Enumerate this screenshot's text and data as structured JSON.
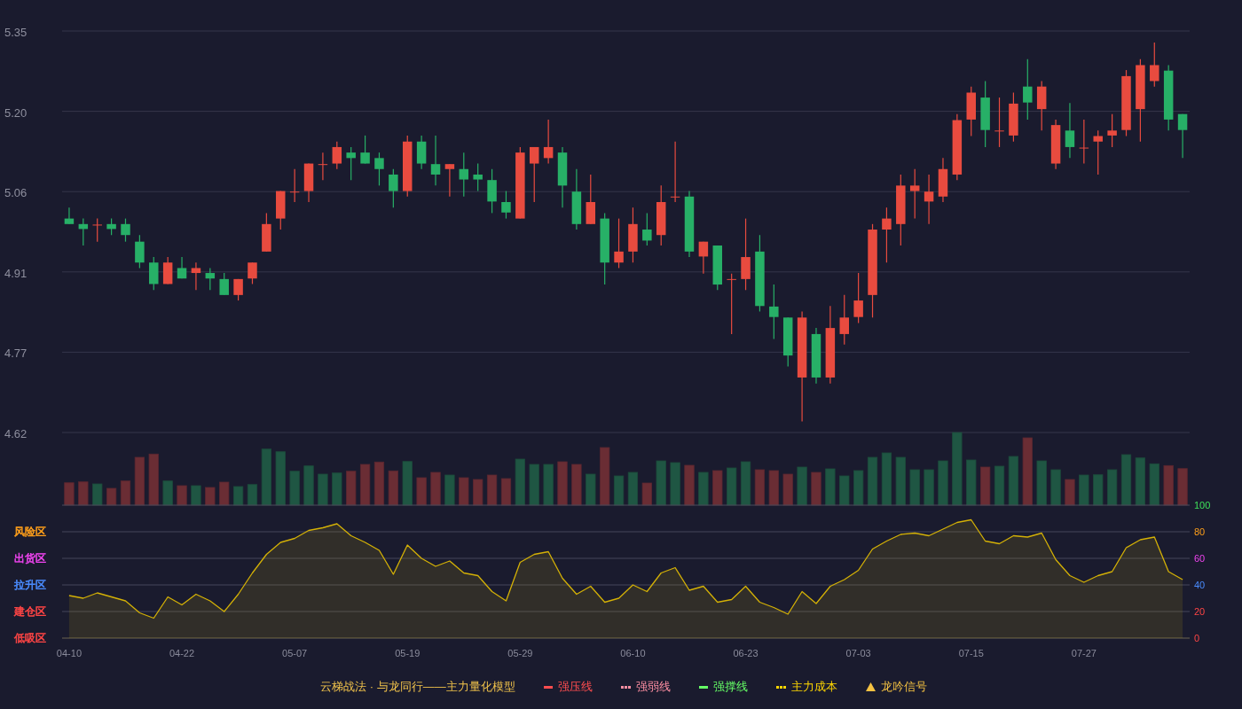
{
  "price_chart": {
    "chart_data": {
      "type": "candlestick",
      "categories": [
        null,
        null,
        null,
        null,
        null,
        null,
        null,
        null,
        null,
        null,
        null,
        null,
        null,
        null,
        null,
        null,
        null,
        null,
        null,
        null,
        null,
        null,
        null,
        null,
        null,
        null,
        null,
        null,
        null,
        null,
        null,
        null,
        null,
        null,
        null,
        null,
        null,
        null,
        null,
        null,
        null,
        null,
        null,
        null,
        null,
        null,
        null,
        null,
        null,
        null,
        null,
        null,
        null,
        null,
        null,
        null,
        null,
        null,
        null,
        null,
        null,
        null,
        null,
        null,
        null,
        null,
        null,
        null,
        null,
        null,
        null,
        null,
        null,
        null,
        null,
        null,
        null,
        null,
        null,
        null
      ],
      "ylim": [
        4.62,
        5.35
      ],
      "yticks": [
        {
          "value": 5.35,
          "label": "5.35"
        },
        {
          "value": 5.204,
          "label": "5.20"
        },
        {
          "value": 5.058,
          "label": "5.06"
        },
        {
          "value": 4.912,
          "label": "4.91"
        },
        {
          "value": 4.766,
          "label": "4.77"
        },
        {
          "value": 4.62,
          "label": "4.62"
        }
      ],
      "grid": true,
      "ohlc": [
        [
          5.009,
          5.029,
          4.999,
          4.999
        ],
        [
          4.999,
          5.009,
          4.96,
          4.99
        ],
        [
          4.998,
          5.009,
          4.967,
          4.998
        ],
        [
          4.999,
          5.009,
          4.979,
          4.99
        ],
        [
          4.999,
          5.009,
          4.967,
          4.979
        ],
        [
          4.967,
          4.979,
          4.919,
          4.929
        ],
        [
          4.929,
          4.939,
          4.879,
          4.89
        ],
        [
          4.89,
          4.939,
          4.89,
          4.929
        ],
        [
          4.919,
          4.939,
          4.9,
          4.9
        ],
        [
          4.91,
          4.929,
          4.879,
          4.919
        ],
        [
          4.91,
          4.919,
          4.879,
          4.9
        ],
        [
          4.899,
          4.91,
          4.87,
          4.87
        ],
        [
          4.87,
          4.899,
          4.86,
          4.899
        ],
        [
          4.9,
          4.929,
          4.89,
          4.929
        ],
        [
          4.949,
          5.019,
          4.949,
          4.999
        ],
        [
          5.009,
          5.059,
          4.989,
          5.059
        ],
        [
          5.058,
          5.099,
          5.039,
          5.058
        ],
        [
          5.059,
          5.109,
          5.039,
          5.109
        ],
        [
          5.108,
          5.129,
          5.079,
          5.108
        ],
        [
          5.109,
          5.149,
          5.099,
          5.139
        ],
        [
          5.129,
          5.139,
          5.079,
          5.119
        ],
        [
          5.129,
          5.16,
          5.109,
          5.109
        ],
        [
          5.119,
          5.129,
          5.069,
          5.099
        ],
        [
          5.089,
          5.099,
          5.029,
          5.059
        ],
        [
          5.059,
          5.16,
          5.049,
          5.149
        ],
        [
          5.149,
          5.16,
          5.099,
          5.109
        ],
        [
          5.108,
          5.16,
          5.069,
          5.089
        ],
        [
          5.099,
          5.108,
          5.049,
          5.108
        ],
        [
          5.099,
          5.129,
          5.049,
          5.08
        ],
        [
          5.089,
          5.109,
          5.059,
          5.08
        ],
        [
          5.079,
          5.099,
          5.019,
          5.04
        ],
        [
          5.039,
          5.059,
          5.009,
          5.02
        ],
        [
          5.009,
          5.139,
          5.009,
          5.129
        ],
        [
          5.109,
          5.139,
          5.039,
          5.139
        ],
        [
          5.119,
          5.189,
          5.109,
          5.139
        ],
        [
          5.129,
          5.139,
          5.029,
          5.069
        ],
        [
          5.058,
          5.099,
          4.989,
          4.999
        ],
        [
          4.999,
          5.089,
          4.999,
          5.039
        ],
        [
          5.009,
          5.019,
          4.889,
          4.929
        ],
        [
          4.929,
          5.009,
          4.919,
          4.949
        ],
        [
          4.949,
          5.029,
          4.929,
          4.999
        ],
        [
          4.989,
          5.019,
          4.96,
          4.969
        ],
        [
          4.979,
          5.069,
          4.96,
          5.039
        ],
        [
          5.049,
          5.149,
          5.039,
          5.049
        ],
        [
          5.049,
          5.059,
          4.939,
          4.949
        ],
        [
          4.94,
          4.967,
          4.909,
          4.967
        ],
        [
          4.96,
          4.96,
          4.879,
          4.889
        ],
        [
          4.899,
          4.909,
          4.799,
          4.899
        ],
        [
          4.899,
          5.009,
          4.879,
          4.939
        ],
        [
          4.949,
          4.979,
          4.84,
          4.85
        ],
        [
          4.849,
          4.889,
          4.79,
          4.83
        ],
        [
          4.829,
          4.829,
          4.74,
          4.76
        ],
        [
          4.72,
          4.84,
          4.64,
          4.829
        ],
        [
          4.799,
          4.81,
          4.709,
          4.72
        ],
        [
          4.72,
          4.85,
          4.709,
          4.81
        ],
        [
          4.799,
          4.87,
          4.78,
          4.829
        ],
        [
          4.83,
          4.91,
          4.819,
          4.86
        ],
        [
          4.87,
          4.999,
          4.829,
          4.989
        ],
        [
          4.989,
          5.029,
          4.929,
          5.009
        ],
        [
          4.999,
          5.089,
          4.96,
          5.069
        ],
        [
          5.059,
          5.099,
          5.009,
          5.069
        ],
        [
          5.04,
          5.089,
          4.999,
          5.058
        ],
        [
          5.049,
          5.119,
          5.039,
          5.099
        ],
        [
          5.089,
          5.199,
          5.079,
          5.188
        ],
        [
          5.189,
          5.249,
          5.159,
          5.238
        ],
        [
          5.229,
          5.259,
          5.139,
          5.17
        ],
        [
          5.169,
          5.229,
          5.139,
          5.169
        ],
        [
          5.16,
          5.238,
          5.149,
          5.218
        ],
        [
          5.249,
          5.299,
          5.189,
          5.22
        ],
        [
          5.208,
          5.259,
          5.169,
          5.249
        ],
        [
          5.109,
          5.189,
          5.099,
          5.179
        ],
        [
          5.169,
          5.219,
          5.119,
          5.139
        ],
        [
          5.138,
          5.189,
          5.109,
          5.138
        ],
        [
          5.149,
          5.169,
          5.089,
          5.159
        ],
        [
          5.16,
          5.199,
          5.139,
          5.169
        ],
        [
          5.17,
          5.279,
          5.159,
          5.268
        ],
        [
          5.208,
          5.299,
          5.149,
          5.288
        ],
        [
          5.259,
          5.329,
          5.249,
          5.288
        ],
        [
          5.278,
          5.288,
          5.169,
          5.189
        ],
        [
          5.199,
          5.199,
          5.119,
          5.17
        ]
      ]
    }
  },
  "oscillator": {
    "zones": [
      {
        "label": "风险区",
        "color": "#ff9f1a"
      },
      {
        "label": "出货区",
        "color": "#f044f0"
      },
      {
        "label": "拉升区",
        "color": "#4a8cff"
      },
      {
        "label": "建仓区",
        "color": "#ff4545"
      },
      {
        "label": "低吸区",
        "color": "#ff4545"
      }
    ],
    "chart_data": {
      "type": "area",
      "categories": [
        "04-10",
        null,
        null,
        null,
        null,
        null,
        null,
        null,
        "04-22",
        null,
        null,
        null,
        null,
        null,
        null,
        null,
        "05-07",
        null,
        null,
        null,
        null,
        null,
        null,
        null,
        "05-19",
        null,
        null,
        null,
        null,
        null,
        null,
        null,
        "05-29",
        null,
        null,
        null,
        null,
        null,
        null,
        null,
        "06-10",
        null,
        null,
        null,
        null,
        null,
        null,
        null,
        "06-23",
        null,
        null,
        null,
        null,
        null,
        null,
        null,
        "07-03",
        null,
        null,
        null,
        null,
        null,
        null,
        null,
        "07-15",
        null,
        null,
        null,
        null,
        null,
        null,
        null,
        "07-27",
        null,
        null,
        null,
        null,
        null,
        null,
        null
      ],
      "ylim": [
        0,
        100
      ],
      "yticks": [
        0,
        20,
        40,
        60,
        80,
        100
      ],
      "grid": true,
      "series": [
        {
          "color": "#d4b106",
          "values": [
            32,
            30,
            34,
            31,
            28,
            19,
            15,
            31,
            25,
            33,
            28,
            20,
            33,
            49,
            63,
            72,
            75,
            81,
            83,
            86,
            77,
            72,
            66,
            48,
            70,
            60,
            54,
            58,
            49,
            47,
            35,
            28,
            57,
            63,
            65,
            45,
            33,
            39,
            27,
            30,
            40,
            35,
            49,
            53,
            36,
            39,
            27,
            29,
            39,
            27,
            23,
            18,
            35,
            26,
            39,
            44,
            51,
            67,
            73,
            78,
            79,
            77,
            82,
            87,
            89,
            73,
            71,
            77,
            76,
            79,
            59,
            47,
            42,
            47,
            50,
            68,
            74,
            76,
            50,
            44
          ]
        }
      ]
    }
  },
  "legend": {
    "title": "云梯战法 · 与龙同行——主力量化模型",
    "items": [
      {
        "label": "强压线",
        "kind": "solid",
        "color": "#ff4d4f"
      },
      {
        "label": "强弱线",
        "kind": "dashed",
        "color": "#ff8fa3"
      },
      {
        "label": "强撑线",
        "kind": "solid",
        "color": "#66ff66"
      },
      {
        "label": "主力成本",
        "kind": "dashed",
        "color": "#ffd700"
      },
      {
        "label": "龙吟信号",
        "kind": "triangle",
        "color": "#f5c242"
      }
    ]
  }
}
